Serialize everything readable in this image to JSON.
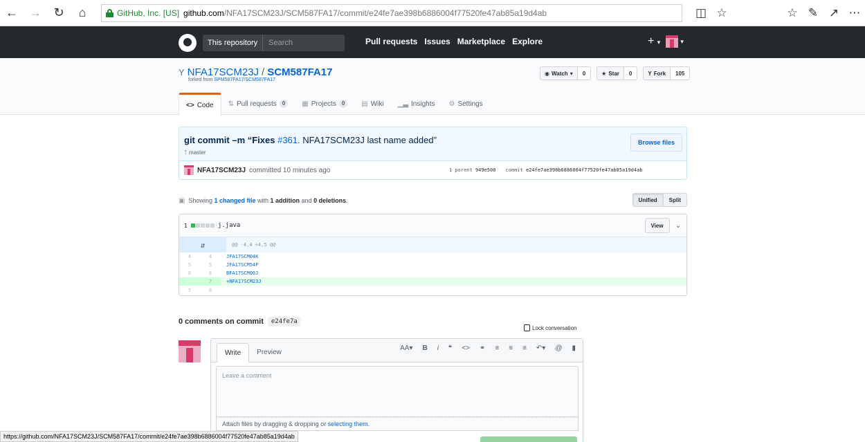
{
  "browser": {
    "cert_label": "GitHub, Inc. [US]",
    "url_host": "github.com",
    "url_path": "/NFA17SCM23J/SCM587FA17/commit/e24fe7ae398b6886004f77520fe47ab85a19d4ab",
    "status_url": "https://github.com/NFA17SCM23J/SCM587FA17/commit/e24fe7ae398b6886004f77520fe47ab85a19d4ab",
    "icons": [
      "back-icon",
      "forward-icon",
      "refresh-icon",
      "home-icon",
      "reading-view-icon",
      "favorite-icon",
      "favorites-hub-icon",
      "notes-icon",
      "share-icon",
      "more-icon"
    ]
  },
  "header": {
    "search_scope": "This repository",
    "search_placeholder": "Search",
    "nav": [
      "Pull requests",
      "Issues",
      "Marketplace",
      "Explore"
    ],
    "plus": "+"
  },
  "repo": {
    "owner": "NFA17SCM23J",
    "sep": "/",
    "name": "SCM587FA17",
    "forked_prefix": "forked from ",
    "forked_link": "SPM587FA17/SCM587FA17",
    "watch_label": "Watch",
    "watch_count": "0",
    "star_label": "Star",
    "star_count": "0",
    "fork_label": "Fork",
    "fork_count": "105",
    "tabs": [
      {
        "label": "Code",
        "icon": "<>"
      },
      {
        "label": "Pull requests",
        "counter": "0"
      },
      {
        "label": "Projects",
        "counter": "0"
      },
      {
        "label": "Wiki"
      },
      {
        "label": "Insights"
      },
      {
        "label": "Settings"
      }
    ]
  },
  "commit": {
    "title_prefix": "git commit –m “Fixes ",
    "issue_link": "#361",
    "title_suffix": ". NFA17SCM23J last name added”",
    "branch": "master",
    "browse_files": "Browse files",
    "author": "NFA17SCM23J",
    "committed": "committed 10 minutes ago",
    "parent_label": "1 parent",
    "parent_sha": "949e500",
    "commit_label": "commit",
    "commit_sha": "e24fe7ae398b6886004f77520fe47ab85a19d4ab"
  },
  "toc": {
    "showing": "Showing ",
    "changed_files": "1 changed file",
    "with": " with ",
    "additions": "1 addition",
    "and": " and ",
    "deletions": "0 deletions",
    "period": ".",
    "unified": "Unified",
    "split": "Split"
  },
  "file": {
    "change_count": "1",
    "filename": "j.java",
    "view_label": "View",
    "hunk_header": "@@ -4,4 +4,5 @@",
    "lines": [
      {
        "old": "4",
        "new": "4",
        "text": "JFA17SCM04K",
        "type": "context"
      },
      {
        "old": "5",
        "new": "5",
        "text": "JFA17SCM54F",
        "type": "context"
      },
      {
        "old": "6",
        "new": "6",
        "text": "BFA17SCM06J",
        "type": "context"
      },
      {
        "old": "",
        "new": "7",
        "text": "+NFA17SCM23J",
        "type": "addition"
      },
      {
        "old": "7",
        "new": "8",
        "text": "",
        "type": "context"
      }
    ]
  },
  "comments": {
    "heading": "0 comments on commit",
    "short_sha": "e24fe7a",
    "lock_label": "Lock conversation",
    "write_tab": "Write",
    "preview_tab": "Preview",
    "placeholder": "Leave a comment",
    "attach_text": "Attach files by dragging & dropping or ",
    "attach_link": "selecting them",
    "attach_end": "."
  }
}
